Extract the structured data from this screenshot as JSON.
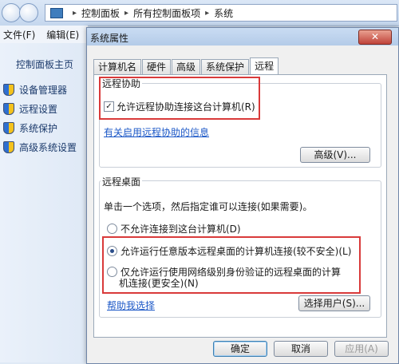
{
  "explorer": {
    "crumbs": [
      "控制面板",
      "所有控制面板项",
      "系统"
    ],
    "menu": [
      "文件(F)",
      "编辑(E)"
    ],
    "home": "控制面板主页",
    "tasks": [
      "设备管理器",
      "远程设置",
      "系统保护",
      "高级系统设置"
    ]
  },
  "dialog": {
    "title": "系统属性",
    "close": "✕",
    "tabs": [
      "计算机名",
      "硬件",
      "高级",
      "系统保护",
      "远程"
    ],
    "active_tab": "远程",
    "assist": {
      "group": "远程协助",
      "checkbox_label": "允许远程协助连接这台计算机(R)",
      "checked": true,
      "info_link": "有关启用远程协助的信息",
      "advanced_button": "高级(V)..."
    },
    "desktop": {
      "group": "远程桌面",
      "instruction": "单击一个选项，然后指定谁可以连接(如果需要)。",
      "options": [
        "不允许连接到这台计算机(D)",
        "允许运行任意版本远程桌面的计算机连接(较不安全)(L)",
        "仅允许运行使用网络级别身份验证的远程桌面的计算",
        "机连接(更安全)(N)"
      ],
      "selected_option": "允许运行任意版本远程桌面的计算机连接(较不安全)(L)",
      "help_link": "帮助我选择",
      "select_users_button": "选择用户(S)..."
    },
    "buttons": {
      "ok": "确定",
      "cancel": "取消",
      "apply": "应用(A)"
    }
  }
}
